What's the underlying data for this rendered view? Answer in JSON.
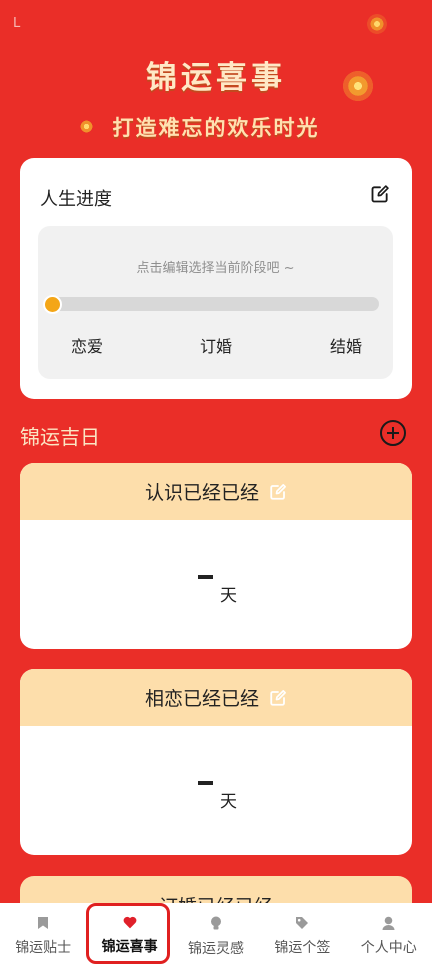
{
  "status": {
    "left": "L"
  },
  "hero": {
    "title": "锦运喜事",
    "subtitle": "打造难忘的欢乐时光"
  },
  "progress": {
    "title": "人生进度",
    "hint": "点击编辑选择当前阶段吧 ~",
    "level": 0,
    "stages": [
      "恋爱",
      "订婚",
      "结婚"
    ]
  },
  "section": {
    "title": "锦运吉日"
  },
  "cards": [
    {
      "title": "认识已经已经",
      "value": "-",
      "unit": "天"
    },
    {
      "title": "相恋已经已经",
      "value": "-",
      "unit": "天"
    },
    {
      "title": "订婚已经已经"
    }
  ],
  "tabs": [
    {
      "label": "锦运贴士",
      "icon": "bookmark-icon"
    },
    {
      "label": "锦运喜事",
      "icon": "heart-icon"
    },
    {
      "label": "锦运灵感",
      "icon": "bulb-icon"
    },
    {
      "label": "锦运个签",
      "icon": "tag-icon"
    },
    {
      "label": "个人中心",
      "icon": "user-icon"
    }
  ],
  "colors": {
    "primary": "#ea2e28",
    "card_header": "#fddeab",
    "accent": "#f4a617",
    "active_tab": "#e02020"
  }
}
